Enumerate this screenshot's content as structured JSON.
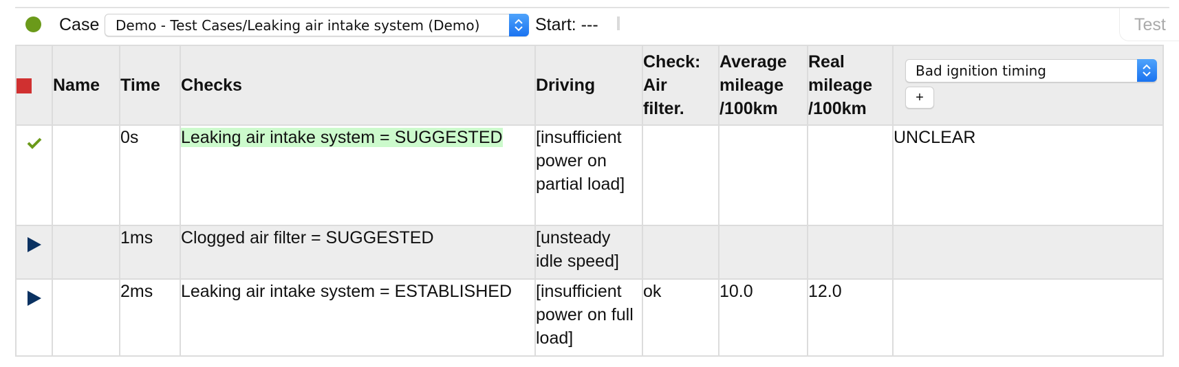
{
  "toolbar": {
    "status_color": "#6b9a1a",
    "case_label": "Case",
    "case_select_value": "Demo - Test Cases/Leaking air intake system (Demo)",
    "start_label": "Start: ---",
    "test_button_label": "Test"
  },
  "table": {
    "header": {
      "stop_icon": "stop-square-icon",
      "columns": [
        "Name",
        "Time",
        "Checks",
        "Driving",
        "Check:\nAir\nfilter.",
        "Average\nmileage\n/100km",
        "Real\nmileage\n/100km"
      ],
      "diagnosis_select_value": "Bad ignition timing",
      "add_button_label": "+"
    },
    "rows": [
      {
        "status_icon": "checkmark-icon",
        "name": "",
        "time": "0s",
        "checks": "Leaking air intake system = SUGGESTED",
        "checks_highlight": true,
        "driving": "[insufficient power on partial load]",
        "air_filter": "",
        "average_mileage": "",
        "real_mileage": "",
        "diagnosis": "UNCLEAR"
      },
      {
        "status_icon": "play-triangle-icon",
        "name": "",
        "time": "1ms",
        "checks": "Clogged air filter = SUGGESTED",
        "checks_highlight": false,
        "driving": "[unsteady idle speed]",
        "air_filter": "",
        "average_mileage": "",
        "real_mileage": "",
        "diagnosis": ""
      },
      {
        "status_icon": "play-triangle-icon",
        "name": "",
        "time": "2ms",
        "checks": "Leaking air intake system = ESTABLISHED",
        "checks_highlight": false,
        "driving": "[insufficient power on full load]",
        "air_filter": "ok",
        "average_mileage": "10.0",
        "real_mileage": "12.0",
        "diagnosis": ""
      }
    ],
    "colors": {
      "stop": "#d03030",
      "check": "#6b9a1a",
      "play": "#0a3161",
      "highlight": "#ccfacc",
      "alt_row": "#ededed"
    }
  }
}
